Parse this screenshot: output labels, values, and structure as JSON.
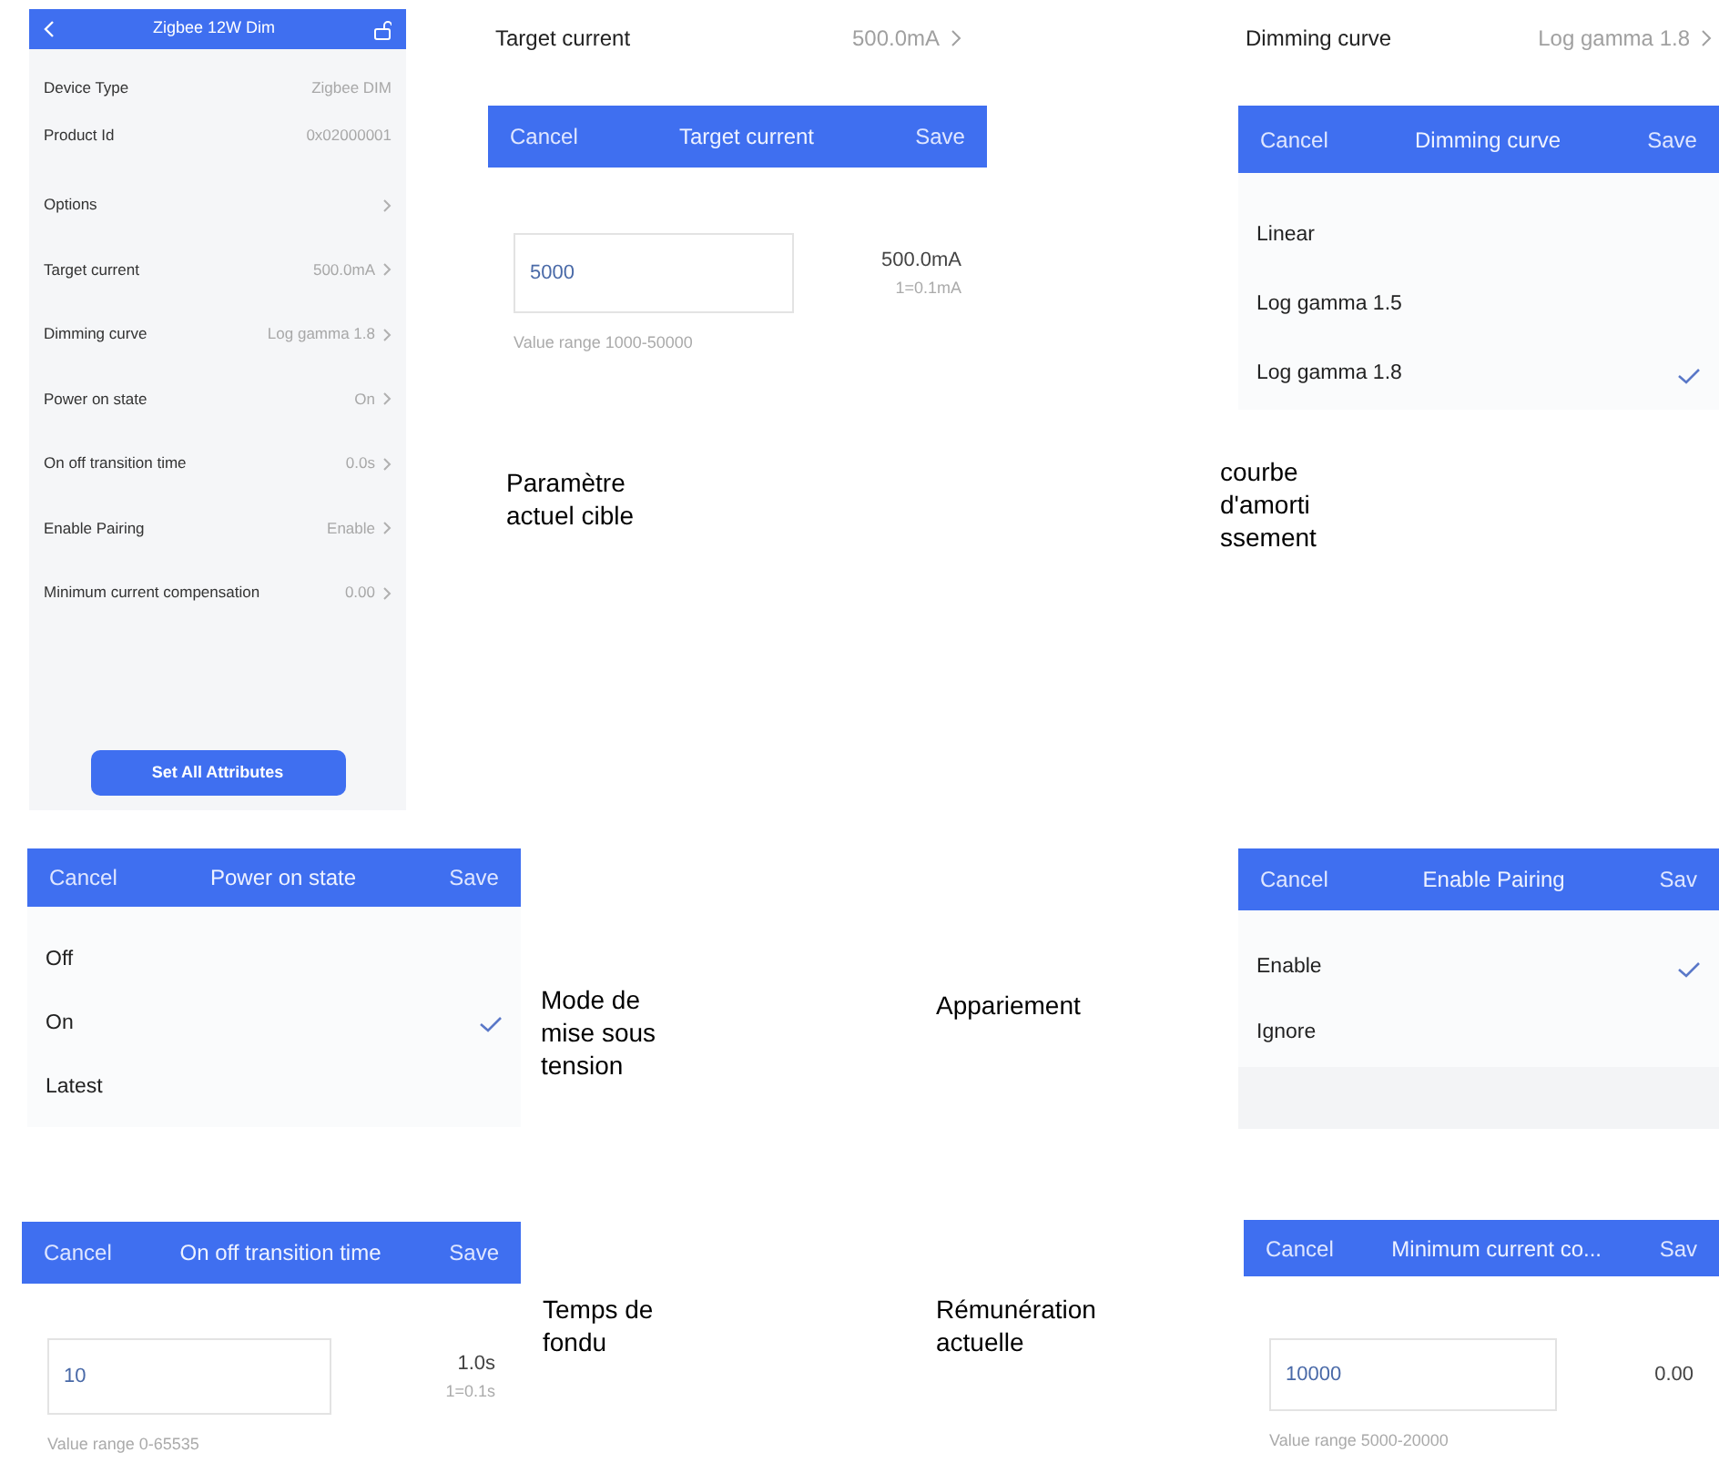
{
  "device_panel": {
    "title": "Zigbee 12W Dim",
    "rows": [
      {
        "label": "Device Type",
        "value": "Zigbee DIM",
        "kind": "info"
      },
      {
        "label": "Product Id",
        "value": "0x02000001",
        "kind": "info"
      },
      {
        "label": "Options",
        "kind": "link"
      },
      {
        "label": "Target current",
        "value": "500.0mA",
        "kind": "link"
      },
      {
        "label": "Dimming curve",
        "value": "Log gamma 1.8",
        "kind": "link"
      },
      {
        "label": "Power on state",
        "value": "On",
        "kind": "link"
      },
      {
        "label": "On off transition time",
        "value": "0.0s",
        "kind": "link"
      },
      {
        "label": "Enable Pairing",
        "value": "Enable",
        "kind": "link"
      },
      {
        "label": "Minimum current compensation",
        "value": "0.00",
        "kind": "link"
      }
    ],
    "button": "Set All Attributes"
  },
  "target_current": {
    "row": {
      "label": "Target current",
      "value": "500.0mA"
    },
    "dialog": {
      "kind": "input",
      "cancel": "Cancel",
      "title": "Target current",
      "save": "Save",
      "value": "5000",
      "reading": "500.0mA",
      "unit_note": "1=0.1mA",
      "range": "Value range 1000-50000"
    },
    "caption": "Paramètre actuel cible"
  },
  "dimming_curve": {
    "row": {
      "label": "Dimming curve",
      "value": "Log gamma 1.8"
    },
    "dialog": {
      "kind": "options",
      "cancel": "Cancel",
      "title": "Dimming curve",
      "save": "Save",
      "options": [
        {
          "label": "Linear",
          "selected": false
        },
        {
          "label": "Log gamma 1.5",
          "selected": false
        },
        {
          "label": "Log gamma 1.8",
          "selected": true
        }
      ]
    },
    "caption": "courbe d'amortissement"
  },
  "power_on_state": {
    "dialog": {
      "kind": "options",
      "cancel": "Cancel",
      "title": "Power on state",
      "save": "Save",
      "options": [
        {
          "label": "Off",
          "selected": false
        },
        {
          "label": "On",
          "selected": true
        },
        {
          "label": "Latest",
          "selected": false
        }
      ]
    },
    "caption": "Mode de mise sous tension"
  },
  "pairing_caption": "Appariement",
  "enable_pairing": {
    "dialog": {
      "kind": "options",
      "cancel": "Cancel",
      "title": "Enable Pairing",
      "save": "Sav",
      "options": [
        {
          "label": "Enable",
          "selected": true
        },
        {
          "label": "Ignore",
          "selected": false
        }
      ]
    }
  },
  "transition_time": {
    "dialog": {
      "kind": "input",
      "cancel": "Cancel",
      "title": "On off transition time",
      "save": "Save",
      "value": "10",
      "reading": "1.0s",
      "unit_note": "1=0.1s",
      "range": "Value range 0-65535"
    },
    "caption": "Temps de fondu"
  },
  "compensation_caption": "Rémunération actuelle",
  "minimum_current": {
    "dialog": {
      "kind": "input",
      "cancel": "Cancel",
      "title": "Minimum current co...",
      "save": "Sav",
      "value": "10000",
      "reading": "0.00",
      "range": "Value range 5000-20000"
    }
  }
}
